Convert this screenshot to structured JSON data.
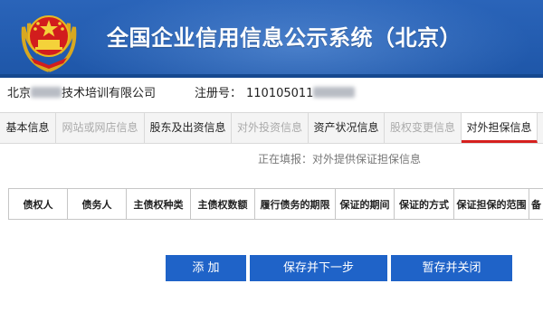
{
  "header": {
    "title": "全国企业信用信息公示系统（北京）"
  },
  "company": {
    "name_prefix": "北京",
    "name_suffix": "技术培训有限公司",
    "reg_label": "注册号：",
    "reg_number_visible": "110105011"
  },
  "tabs": [
    {
      "label": "基本信息",
      "state": "normal"
    },
    {
      "label": "网站或网店信息",
      "state": "disabled"
    },
    {
      "label": "股东及出资信息",
      "state": "normal"
    },
    {
      "label": "对外投资信息",
      "state": "disabled"
    },
    {
      "label": "资产状况信息",
      "state": "normal"
    },
    {
      "label": "股权变更信息",
      "state": "disabled"
    },
    {
      "label": "对外担保信息",
      "state": "active"
    }
  ],
  "notice": "正在填报：对外提供保证担保信息",
  "table": {
    "headers": [
      "债权人",
      "债务人",
      "主债权种类",
      "主债权数额",
      "履行债务的期限",
      "保证的期间",
      "保证的方式",
      "保证担保的范围",
      "备"
    ]
  },
  "buttons": {
    "add": "添 加",
    "save_next": "保存并下一步",
    "save_close": "暂存并关闭"
  },
  "colors": {
    "header_bg": "#2a64b9",
    "button_bg": "#1f63c8",
    "active_tab_underline": "#d6201e"
  }
}
